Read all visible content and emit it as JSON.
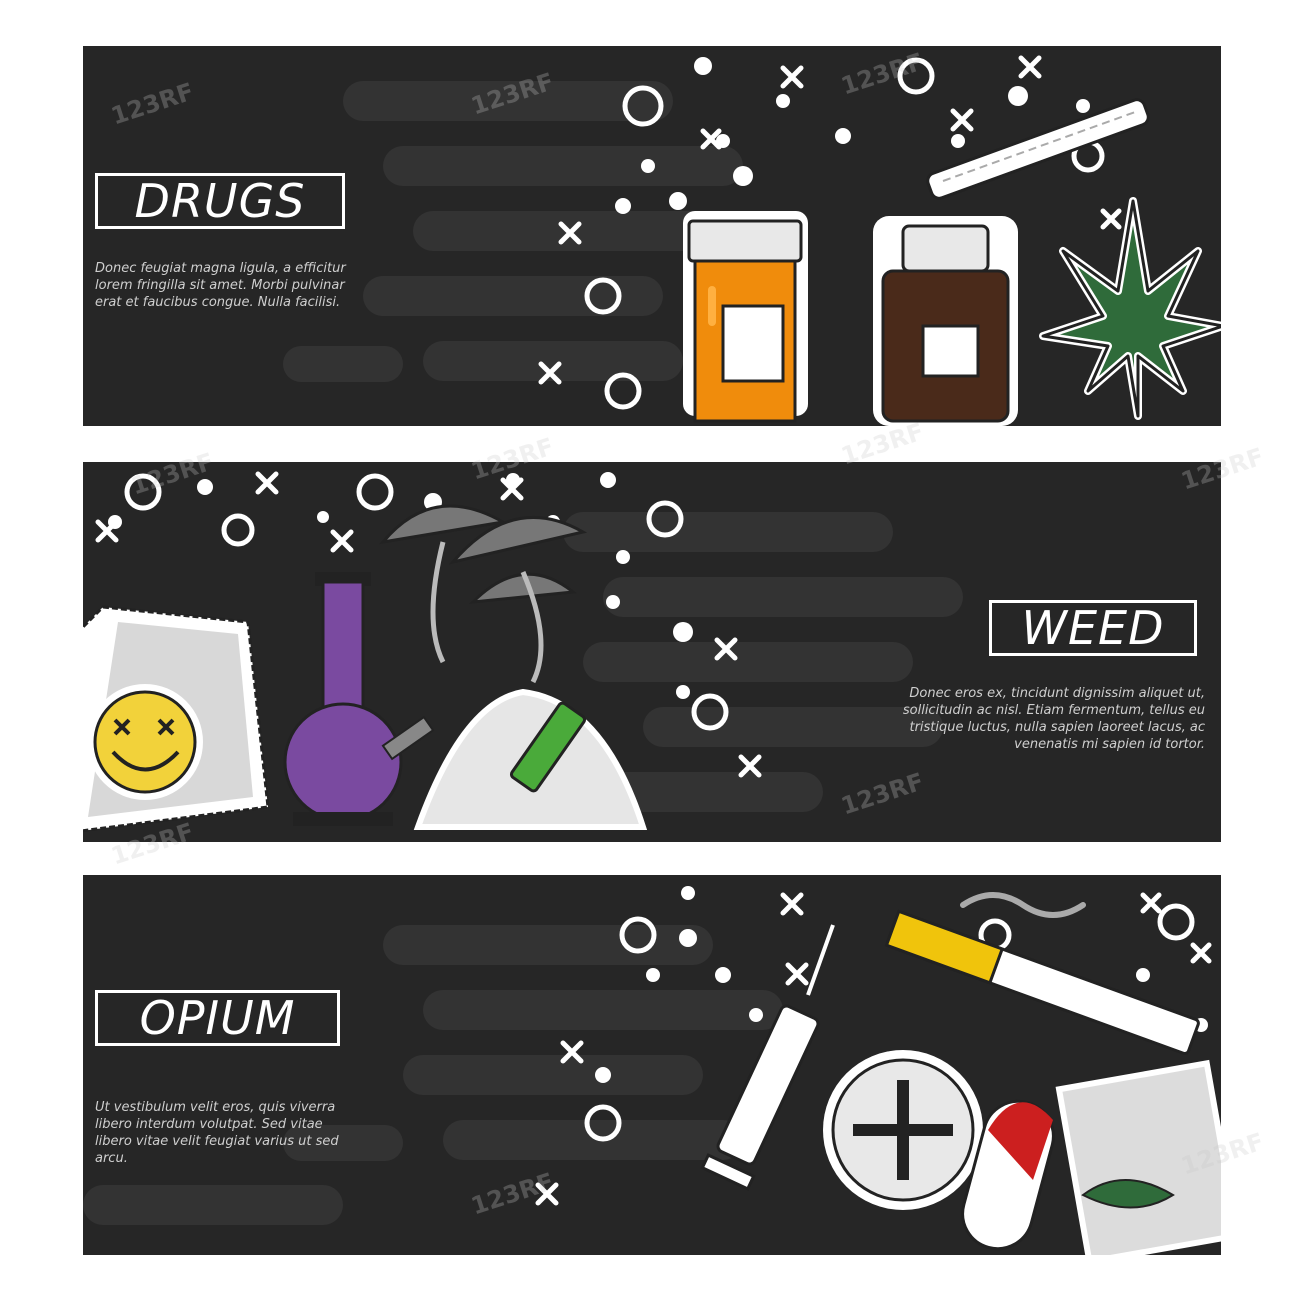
{
  "banners": [
    {
      "title": "DRUGS",
      "text": "Donec feugiat magna ligula, a efficitur\nlorem fringilla sit amet. Morbi pulvinar\nerat et faucibus congue. Nulla facilisi."
    },
    {
      "title": "WEED",
      "text": "Donec eros ex, tincidunt dignissim aliquet ut,\nsollicitudin ac nisl. Etiam fermentum, tellus eu\ntristique luctus, nulla sapien laoreet lacus, ac\nvenenatis mi sapien id tortor."
    },
    {
      "title": "OPIUM",
      "text": "Ut vestibulum velit eros, quis viverra\nlibero interdum volutpat. Sed vitae\n libero vitae velit feugiat varius ut sed\narcu."
    }
  ],
  "watermark": "123RF",
  "colors": {
    "banner_bg": "#262626",
    "pill_orange": "#f08c0c",
    "bottle_brown": "#4a2a1a",
    "leaf_green": "#2f6b3a",
    "bong_purple": "#7a4aa0",
    "smiley_yellow": "#f2d23a",
    "lighter_green": "#4aaa3a",
    "cigarette_yellow": "#f0c40c",
    "red": "#cc1f1f"
  },
  "icons": [
    "pill-bottle-icon",
    "medicine-bottle-icon",
    "cannabis-leaf-icon",
    "joint-icon",
    "blotter-paper-icon",
    "smiley-icon",
    "bong-icon",
    "mushroom-icon",
    "powder-pile-icon",
    "lighter-icon",
    "syringe-icon",
    "cigarette-icon",
    "tablet-icon",
    "capsule-icon",
    "baggie-icon"
  ]
}
